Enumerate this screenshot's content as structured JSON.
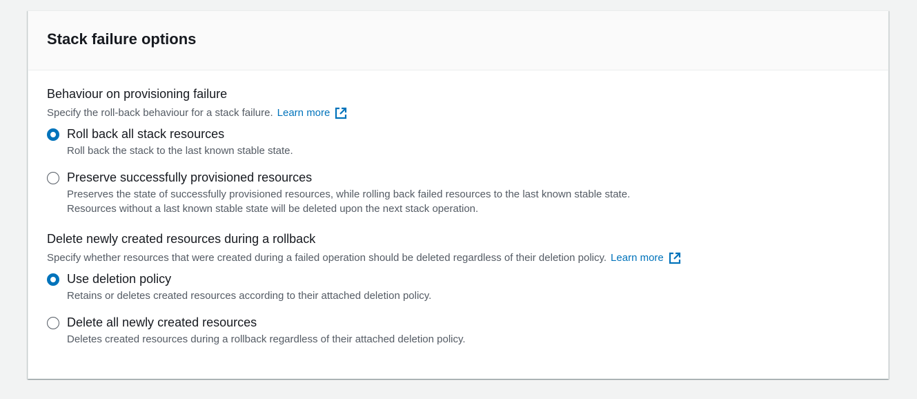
{
  "panel": {
    "title": "Stack failure options"
  },
  "sections": [
    {
      "label": "Behaviour on provisioning failure",
      "description": "Specify the roll-back behaviour for a stack failure.",
      "learn_more": "Learn more",
      "options": [
        {
          "label": "Roll back all stack resources",
          "description": "Roll back the stack to the last known stable state.",
          "checked": true
        },
        {
          "label": "Preserve successfully provisioned resources",
          "description": "Preserves the state of successfully provisioned resources, while rolling back failed resources to the last known stable state. Resources without a last known stable state will be deleted upon the next stack operation.",
          "checked": false
        }
      ]
    },
    {
      "label": "Delete newly created resources during a rollback",
      "description": "Specify whether resources that were created during a failed operation should be deleted regardless of their deletion policy.",
      "learn_more": "Learn more",
      "options": [
        {
          "label": "Use deletion policy",
          "description": "Retains or deletes created resources according to their attached deletion policy.",
          "checked": true
        },
        {
          "label": "Delete all newly created resources",
          "description": "Deletes created resources during a rollback regardless of their attached deletion policy.",
          "checked": false
        }
      ]
    }
  ],
  "colors": {
    "accent": "#0073bb",
    "text": "#16191f",
    "secondary_text": "#545b64"
  }
}
